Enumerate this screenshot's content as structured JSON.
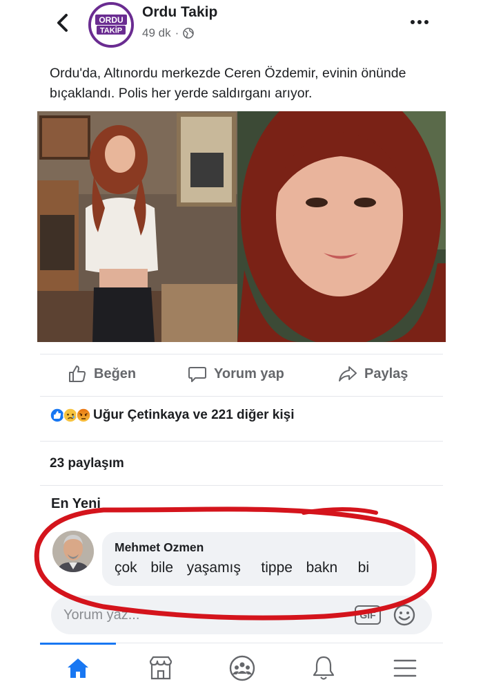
{
  "header": {
    "page_name": "Ordu Takip",
    "time": "49 dk",
    "separator": "·",
    "logo_line1": "ORDU",
    "logo_line2": "TAKİP"
  },
  "post": {
    "text": "Ordu'da, Altınordu merkezde Ceren Özdemir, evinin önünde bıçaklandı. Polis her yerde saldırganı arıyor."
  },
  "actions": {
    "like": "Beğen",
    "comment": "Yorum yap",
    "share": "Paylaş"
  },
  "reactions": {
    "summary": "Uğur Çetinkaya ve 221 diğer kişi",
    "types": [
      "like",
      "sad",
      "angry"
    ]
  },
  "shares": "23 paylaşım",
  "comments_sort": "En Yeni",
  "comment": {
    "author": "Mehmet Ozmen",
    "text": "çok  bile  yaşamış   tippe  bakn   bi"
  },
  "composer": {
    "placeholder": "Yorum yaz...",
    "gif_label": "GIF"
  },
  "colors": {
    "accent": "#1877f2",
    "brand_purple": "#6a2c91",
    "annotation_red": "#d4141c"
  },
  "bottom_nav": [
    "home-icon",
    "marketplace-icon",
    "groups-icon",
    "notifications-icon",
    "menu-icon"
  ]
}
